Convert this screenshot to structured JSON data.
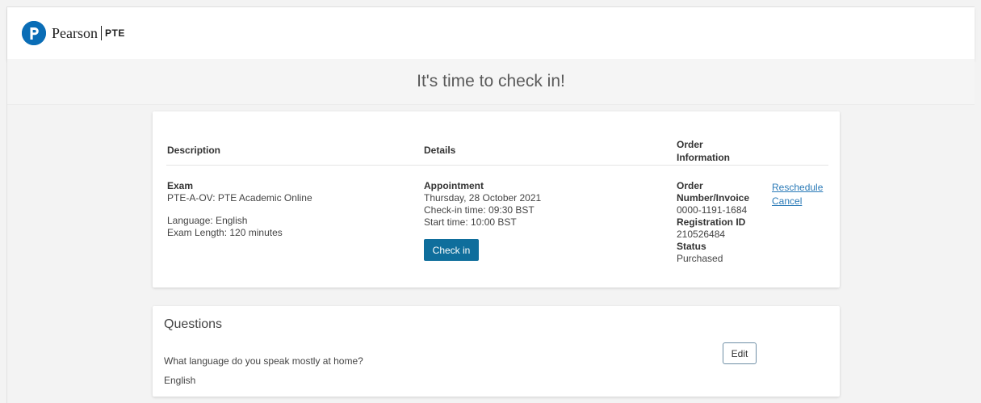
{
  "header": {
    "logo_text": "Pearson",
    "logo_product": "PTE"
  },
  "banner": {
    "title": "It's time to check in!"
  },
  "order": {
    "columns": {
      "description": "Description",
      "details": "Details",
      "order_info_line1": "Order",
      "order_info_line2": "Information"
    },
    "description": {
      "type_label": "Exam",
      "exam_name": "PTE-A-OV: PTE Academic Online",
      "language": "Language: English",
      "exam_length": "Exam Length: 120 minutes"
    },
    "details": {
      "heading": "Appointment",
      "date": "Thursday, 28 October 2021",
      "checkin_time": "Check-in time: 09:30 BST",
      "start_time": "Start time: 10:00 BST",
      "checkin_button": "Check in"
    },
    "order_info": {
      "order_number_label_1": "Order",
      "order_number_label_2": "Number/Invoice",
      "order_number_value": "0000-1191-1684",
      "registration_label": "Registration ID",
      "registration_value": "210526484",
      "status_label": "Status",
      "status_value": "Purchased"
    },
    "actions": {
      "reschedule": "Reschedule",
      "cancel": "Cancel"
    }
  },
  "questions": {
    "title": "Questions",
    "question": "What language do you speak mostly at home?",
    "answer": "English",
    "edit_button": "Edit"
  },
  "colors": {
    "brand_blue": "#0a6db6",
    "button_teal": "#0f6e9c",
    "link_blue": "#2a7ab7"
  }
}
